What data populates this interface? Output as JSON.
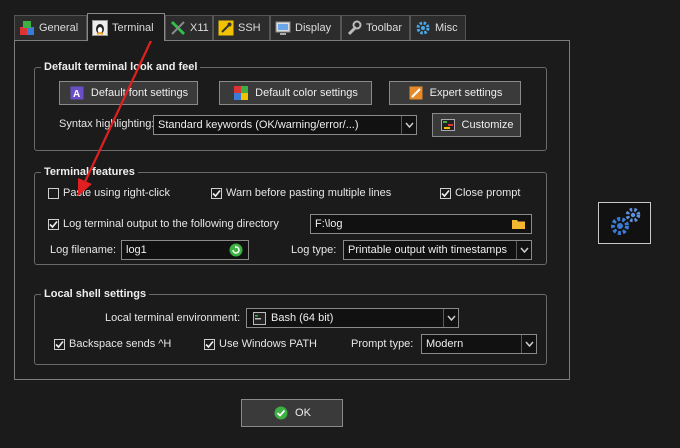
{
  "tabs": [
    {
      "label": "General",
      "icon": "general-colors-icon"
    },
    {
      "label": "Terminal",
      "icon": "terminal-penguin-icon",
      "active": true
    },
    {
      "label": "X11",
      "icon": "x11-icon"
    },
    {
      "label": "SSH",
      "icon": "ssh-key-icon"
    },
    {
      "label": "Display",
      "icon": "monitor-icon"
    },
    {
      "label": "Toolbar",
      "icon": "wrench-icon"
    },
    {
      "label": "Misc",
      "icon": "gear-icon"
    }
  ],
  "look_and_feel": {
    "title": "Default terminal look and feel",
    "font_button": "Default font settings",
    "color_button": "Default color settings",
    "expert_button": "Expert settings",
    "syntax_label": "Syntax highlighting:",
    "syntax_value": "Standard keywords (OK/warning/error/...)",
    "customize_button": "Customize"
  },
  "features": {
    "title": "Terminal features",
    "paste_right_click": {
      "label": "Paste using right-click",
      "checked": false
    },
    "warn_multiple_lines": {
      "label": "Warn before pasting multiple lines",
      "checked": true
    },
    "close_prompt": {
      "label": "Close prompt",
      "checked": true
    },
    "log_output": {
      "label": "Log terminal output to the following directory",
      "checked": true
    },
    "log_directory": "F:\\log",
    "log_filename_label": "Log filename:",
    "log_filename_value": "log1",
    "log_type_label": "Log type:",
    "log_type_value": "Printable output with timestamps"
  },
  "local_shell": {
    "title": "Local shell settings",
    "env_label": "Local terminal environment:",
    "env_value": "Bash (64 bit)",
    "backspace": {
      "label": "Backspace sends ^H",
      "checked": true
    },
    "windows_path": {
      "label": "Use Windows PATH",
      "checked": true
    },
    "prompt_type_label": "Prompt type:",
    "prompt_type_value": "Modern"
  },
  "ok_button": "OK",
  "colors": {
    "accent_red": "#e02020",
    "side_button_blue": "#3a7bd5"
  }
}
